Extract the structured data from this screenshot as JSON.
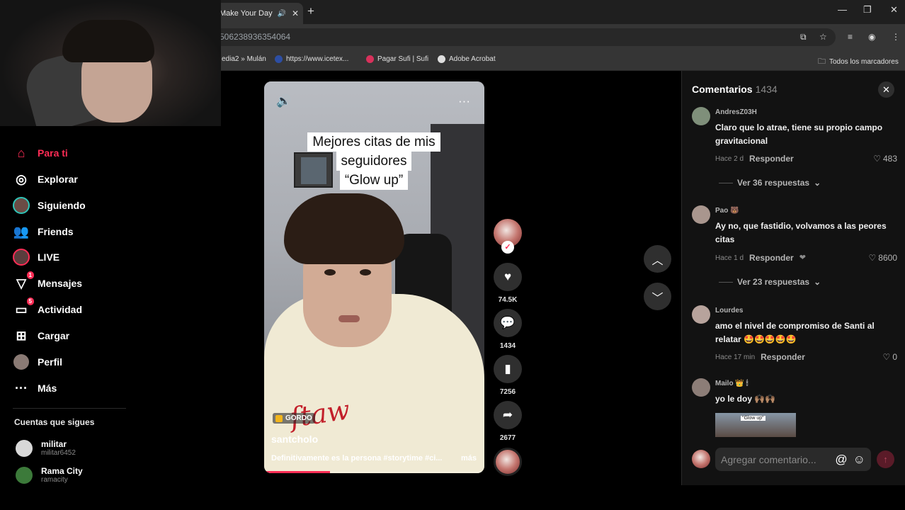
{
  "browser": {
    "tab_title": "Make Your Day",
    "address": "506238936354064",
    "bookmarks": [
      "edia2 » Mulán",
      "https://www.icetex...",
      "Pagar Sufi | Sufi",
      "Adobe Acrobat"
    ],
    "all_bookmarks": "Todos los marcadores"
  },
  "nav": {
    "items": [
      {
        "label": "Para ti",
        "icon": "home-icon"
      },
      {
        "label": "Explorar",
        "icon": "compass-icon"
      },
      {
        "label": "Siguiendo",
        "icon": "following-avatar-icon"
      },
      {
        "label": "Friends",
        "icon": "friends-icon"
      },
      {
        "label": "LIVE",
        "icon": "live-icon"
      },
      {
        "label": "Mensajes",
        "icon": "send-icon",
        "badge": "1"
      },
      {
        "label": "Actividad",
        "icon": "inbox-icon",
        "badge": "5"
      },
      {
        "label": "Cargar",
        "icon": "upload-icon"
      },
      {
        "label": "Perfil",
        "icon": "profile-avatar-icon"
      },
      {
        "label": "Más",
        "icon": "more-icon"
      }
    ],
    "following_title": "Cuentas que sigues",
    "accounts": [
      {
        "name": "militar",
        "username": "militar6452"
      },
      {
        "name": "Rama City",
        "username": "ramacity"
      }
    ]
  },
  "video": {
    "caption_lines": [
      "Mejores citas de mis",
      "seguidores",
      "“Glow up”"
    ],
    "tag": "GORDO",
    "author": "santcholo",
    "description": "Definitivamente es la persona #storytime #ci...",
    "more": "más",
    "progress": 0.3
  },
  "actions": {
    "likes": "74.5K",
    "comments": "1434",
    "saves": "7256",
    "shares": "2677"
  },
  "comments_panel": {
    "title": "Comentarios",
    "count": "1434",
    "comments": [
      {
        "user": "AndresZ03H",
        "text": "Claro que lo atrae, tiene su propio campo gravitacional",
        "time": "Hace 2 d",
        "reply": "Responder",
        "likes": "483",
        "view_replies": "Ver 36 respuestas"
      },
      {
        "user": "Pao 🐻",
        "text": "Ay no, que fastidio, volvamos a las peores citas",
        "time": "Hace 1 d",
        "reply": "Responder",
        "likes": "8600",
        "view_replies": "Ver 23 respuestas"
      },
      {
        "user": "Lourdes",
        "text": "amo el nivel de compromiso de Santi al relatar 🤩🤩🤩🤩🤩",
        "time": "Hace 17 min",
        "reply": "Responder",
        "likes": "0"
      },
      {
        "user": "Mailo 👑 🕯",
        "text": "yo le doy 🙌🏽🙌🏽"
      }
    ],
    "thumb_caption": "\"Glow up\"",
    "input_placeholder": "Agregar comentario..."
  }
}
